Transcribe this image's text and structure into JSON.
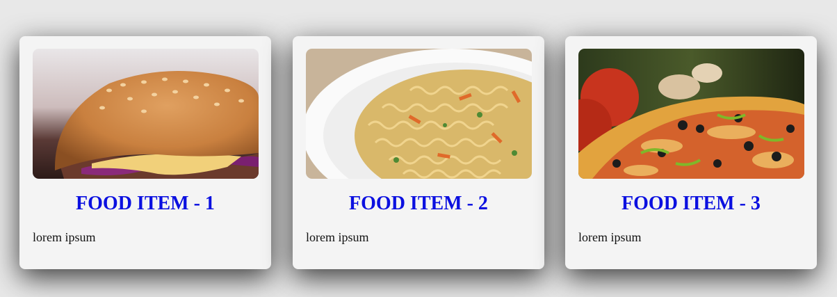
{
  "cards": [
    {
      "title": "FOOD ITEM - 1",
      "description": "lorem ipsum",
      "image": "burger-photo"
    },
    {
      "title": "FOOD ITEM - 2",
      "description": "lorem ipsum",
      "image": "noodles-photo"
    },
    {
      "title": "FOOD ITEM - 3",
      "description": "lorem ipsum",
      "image": "pizza-photo"
    }
  ],
  "colors": {
    "page_background": "#e8e8e8",
    "card_background": "#f4f4f4",
    "title": "#0b10e0",
    "text": "#111111"
  }
}
